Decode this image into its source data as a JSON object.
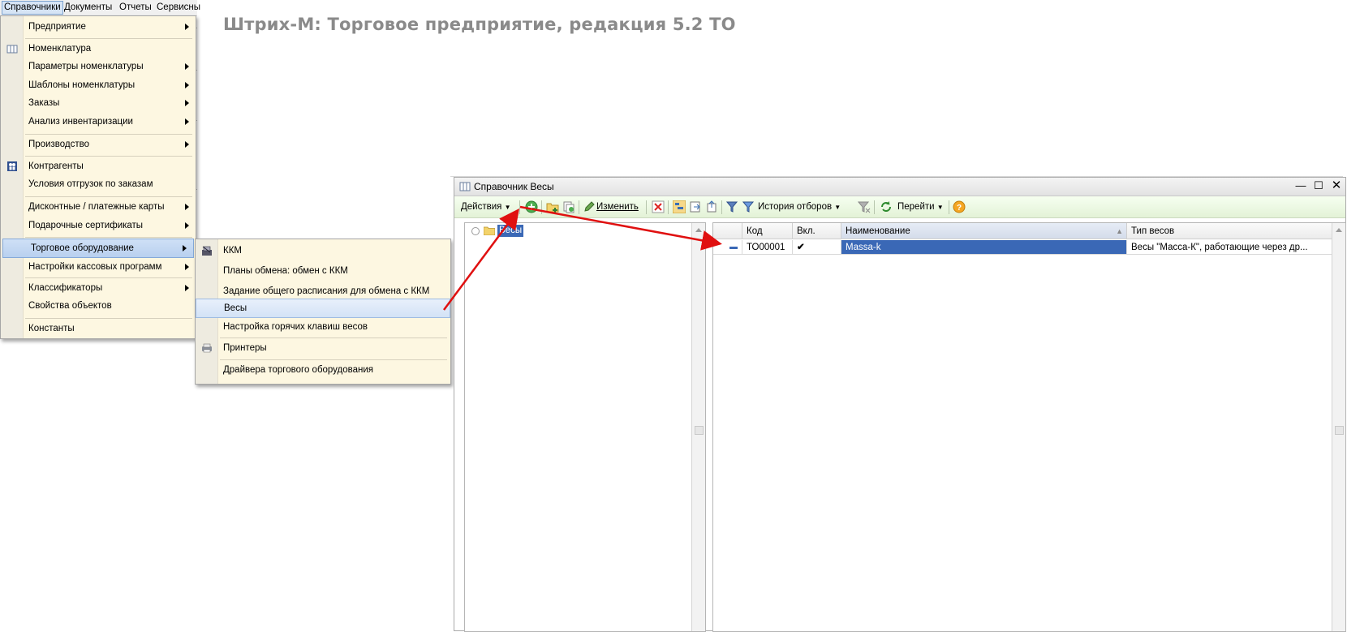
{
  "page_title": "Штрих-М: Торговое предприятие, редакция 5.2 ТО",
  "menubar": {
    "items": [
      "Справочники",
      "Документы",
      "Отчеты",
      "Сервисны"
    ]
  },
  "main_menu": {
    "items": [
      {
        "label": "Предприятие",
        "submenu": true
      },
      {
        "label": "Номенклатура",
        "icon": "catalog-icon"
      },
      {
        "label": "Параметры номенклатуры",
        "submenu": true
      },
      {
        "label": "Шаблоны номенклатуры",
        "submenu": true
      },
      {
        "label": "Заказы",
        "submenu": true
      },
      {
        "label": "Анализ инвентаризации",
        "submenu": true
      },
      {
        "label": "Производство",
        "submenu": true
      },
      {
        "label": "Контрагенты",
        "icon": "people-icon"
      },
      {
        "label": "Условия отгрузок по заказам"
      },
      {
        "label": "Дисконтные / платежные карты",
        "submenu": true
      },
      {
        "label": "Подарочные сертификаты",
        "submenu": true
      },
      {
        "label": "Торговое оборудование",
        "submenu": true,
        "selected": true
      },
      {
        "label": "Настройки кассовых программ",
        "submenu": true
      },
      {
        "label": "Классификаторы",
        "submenu": true
      },
      {
        "label": "Свойства объектов"
      },
      {
        "label": "Константы"
      }
    ]
  },
  "sub_menu": {
    "items": [
      {
        "label": "ККМ",
        "icon": "cash-register-icon"
      },
      {
        "label": "Планы обмена: обмен с ККМ"
      },
      {
        "label": "Задание общего расписания для обмена с ККМ"
      },
      {
        "label": "Весы",
        "selected": true
      },
      {
        "label": "Настройка горячих клавиш весов"
      },
      {
        "label": "Принтеры",
        "icon": "printer-icon"
      },
      {
        "label": "Драйвера торгового оборудования"
      }
    ]
  },
  "window": {
    "title": "Справочник Весы",
    "toolbar": {
      "actions": "Действия",
      "edit": "Изменить",
      "history": "История отборов",
      "goto": "Перейти"
    },
    "tree": {
      "root": "Весы"
    },
    "grid": {
      "columns": [
        "Код",
        "Вкл.",
        "Наименование",
        "Тип весов"
      ],
      "rows": [
        {
          "code": "ТО00001",
          "enabled": "✔",
          "name": "Massa-k",
          "type": "Весы \"Масса-К\", работающие через др..."
        }
      ]
    }
  },
  "colors": {
    "menu_bg": "#fdf7e1",
    "selection": "#3a68b6",
    "toolbar_bg": "#e3f2d7",
    "arrow": "#e01010"
  }
}
